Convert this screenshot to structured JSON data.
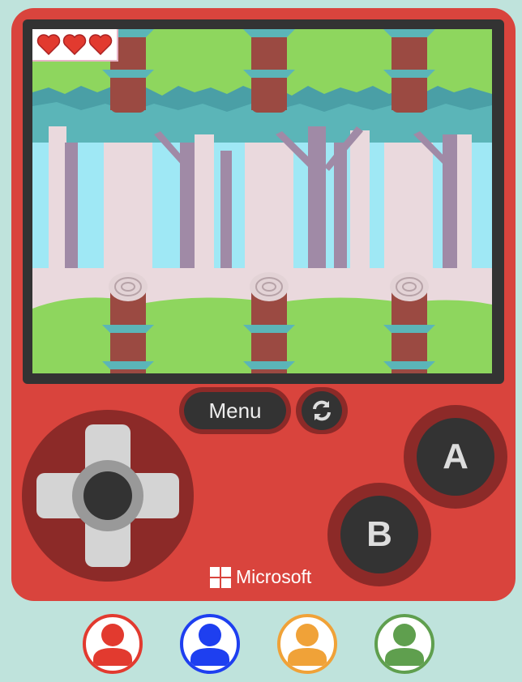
{
  "game": {
    "lives": 3,
    "heart_icon": "heart-icon",
    "scene": "forest-logs"
  },
  "controls": {
    "menu_label": "Menu",
    "reset_icon": "refresh-icon",
    "a_label": "A",
    "b_label": "B"
  },
  "brand": {
    "name": "Microsoft",
    "logo": "windows-logo-icon"
  },
  "players": [
    {
      "name": "player-1",
      "color": "#e23a2f"
    },
    {
      "name": "player-2",
      "color": "#1e3ff0"
    },
    {
      "name": "player-3",
      "color": "#f0a238"
    },
    {
      "name": "player-4",
      "color": "#5f9f4e"
    }
  ],
  "colors": {
    "console": "#d9443d",
    "console_dark": "#8c2a28",
    "background": "#bfe3dc",
    "sky": "#9fe8f5",
    "grass": "#8ed65e"
  }
}
